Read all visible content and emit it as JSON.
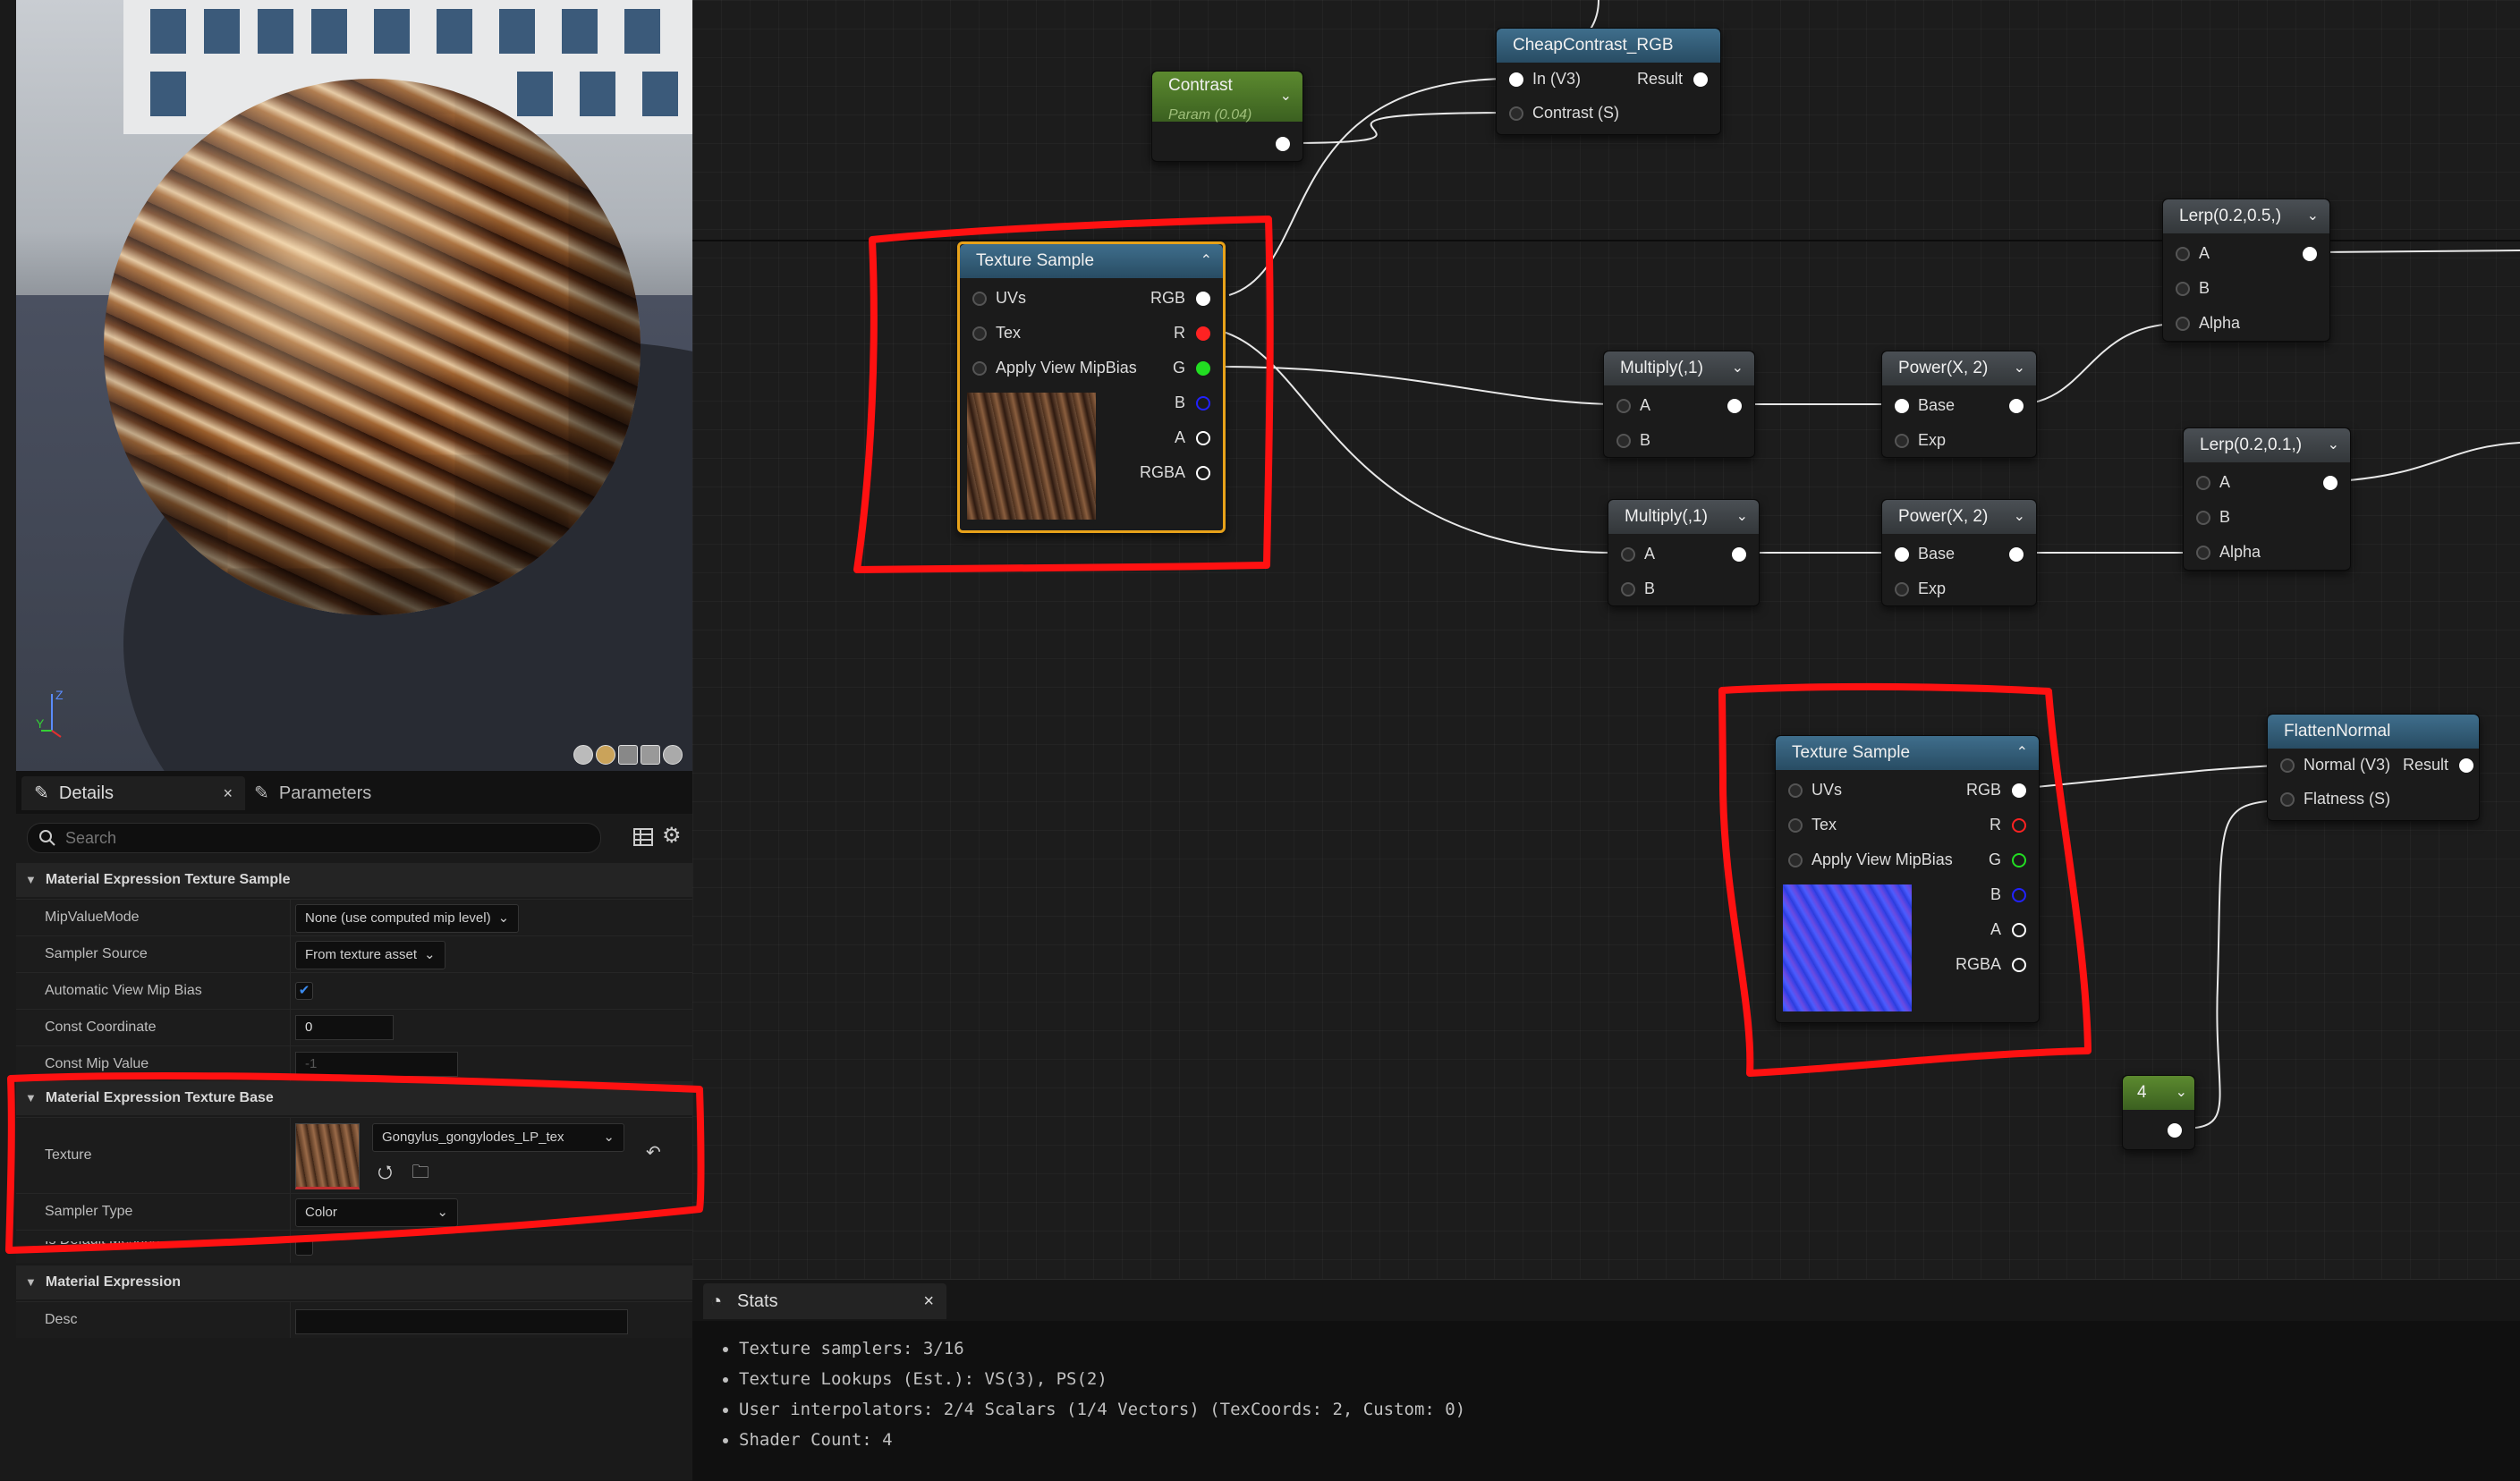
{
  "viewport": {
    "axis_z": "Z",
    "axis_y": "Y"
  },
  "details_panel": {
    "tabs": [
      {
        "label": "Details",
        "close": "×"
      },
      {
        "label": "Parameters"
      }
    ],
    "search_placeholder": "Search",
    "sections": {
      "texture_sample": {
        "title": "Material Expression Texture Sample",
        "rows": {
          "mip_value_mode": {
            "label": "MipValueMode",
            "value": "None (use computed mip level)"
          },
          "sampler_source": {
            "label": "Sampler Source",
            "value": "From texture asset"
          },
          "auto_view_mip_bias": {
            "label": "Automatic View Mip Bias",
            "checked": true,
            "check": "✔"
          },
          "const_coordinate": {
            "label": "Const Coordinate",
            "value": "0"
          },
          "const_mip_value": {
            "label": "Const Mip Value",
            "value": "-1"
          }
        }
      },
      "texture_base": {
        "title": "Material Expression Texture Base",
        "rows": {
          "texture": {
            "label": "Texture",
            "value": "Gongylus_gongylodes_LP_tex"
          },
          "sampler_type": {
            "label": "Sampler Type",
            "value": "Color"
          },
          "is_default_meshpaint": {
            "label": "Is Default Meshpaint Texture",
            "checked": false
          }
        }
      },
      "expression": {
        "title": "Material Expression",
        "rows": {
          "desc": {
            "label": "Desc",
            "value": ""
          }
        }
      }
    }
  },
  "graph": {
    "nodes": {
      "contrast": {
        "title": "Contrast",
        "subtitle": "Param (0.04)"
      },
      "cheap_contrast": {
        "title": "CheapContrast_RGB",
        "pins_in": [
          "In (V3)",
          "Contrast (S)"
        ],
        "pin_out": "Result"
      },
      "texture_sample_1": {
        "title": "Texture Sample",
        "pins_in": [
          "UVs",
          "Tex",
          "Apply View MipBias"
        ],
        "pins_out": [
          "RGB",
          "R",
          "G",
          "B",
          "A",
          "RGBA"
        ]
      },
      "multiply_1": {
        "title": "Multiply(,1)",
        "pins_in": [
          "A",
          "B"
        ]
      },
      "multiply_2": {
        "title": "Multiply(,1)",
        "pins_in": [
          "A",
          "B"
        ]
      },
      "power_1": {
        "title": "Power(X, 2)",
        "pins_in": [
          "Base",
          "Exp"
        ]
      },
      "power_2": {
        "title": "Power(X, 2)",
        "pins_in": [
          "Base",
          "Exp"
        ]
      },
      "lerp_1": {
        "title": "Lerp(0.2,0.5,)",
        "pins_in": [
          "A",
          "B",
          "Alpha"
        ]
      },
      "lerp_2": {
        "title": "Lerp(0.2,0.1,)",
        "pins_in": [
          "A",
          "B",
          "Alpha"
        ]
      },
      "texture_sample_2": {
        "title": "Texture Sample",
        "pins_in": [
          "UVs",
          "Tex",
          "Apply View MipBias"
        ],
        "pins_out": [
          "RGB",
          "R",
          "G",
          "B",
          "A",
          "RGBA"
        ]
      },
      "flatten_normal": {
        "title": "FlattenNormal",
        "pins_in": [
          "Normal (V3)",
          "Flatness (S)"
        ],
        "pin_out": "Result"
      },
      "constant_4": {
        "title": "4"
      }
    },
    "colors": {
      "selected_border": "#e8a21a",
      "annotation_red": "#ff1111",
      "pin_r": "#ff2222",
      "pin_g": "#22dd22",
      "pin_b": "#2222ff"
    }
  },
  "stats": {
    "tab_label": "Stats",
    "close": "×",
    "lines": [
      "Texture samplers: 3/16",
      "Texture Lookups (Est.): VS(3), PS(2)",
      "User interpolators: 2/4 Scalars (1/4 Vectors) (TexCoords: 2, Custom: 0)",
      "Shader Count: 4"
    ]
  }
}
